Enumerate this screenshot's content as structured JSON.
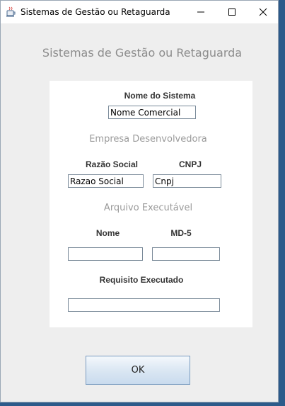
{
  "window": {
    "title": "Sistemas de Gestão ou Retaguarda",
    "icon": "java-cup-icon"
  },
  "heading": "Sistemas de Gestão ou Retaguarda",
  "sistema": {
    "label": "Nome do Sistema",
    "value": "Nome Comercial"
  },
  "empresa": {
    "section_title": "Empresa Desenvolvedora",
    "razao_label": "Razão Social",
    "razao_value": "Razao Social",
    "cnpj_label": "CNPJ",
    "cnpj_value": "Cnpj"
  },
  "arquivo": {
    "section_title": "Arquivo Executável",
    "nome_label": "Nome",
    "nome_value": "",
    "md5_label": "MD-5",
    "md5_value": ""
  },
  "requisito": {
    "label": "Requisito Executado",
    "value": ""
  },
  "ok_label": "OK",
  "colors": {
    "desktop": "#2c5a8a",
    "window_bg": "#eeeeee",
    "panel_bg": "#ffffff",
    "muted_text": "#8c8c8c"
  }
}
